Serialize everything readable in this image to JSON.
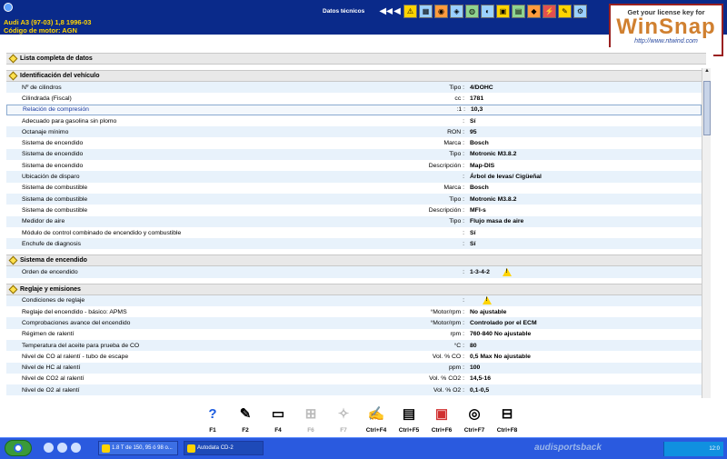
{
  "header": {
    "vehicle": "Audi  A3 (97-03) 1,8  1996-03",
    "engine": "Código de motor: AGN",
    "section_title": "Datos técnicos"
  },
  "toolbar": [
    "◀◀",
    "◀",
    "⚠",
    "▦",
    "◉",
    "◈",
    "◍",
    "◐",
    "▣",
    "▤",
    "◆",
    "⚡",
    "✎",
    "⚙"
  ],
  "winsnap": {
    "line1": "Get your license key for",
    "line2": "WinSnap",
    "line3": "http://www.ntwind.com"
  },
  "content": {
    "full_list": "Lista completa de datos",
    "sections": [
      {
        "title": "Identificación del vehículo",
        "rows": [
          {
            "label": "Nº de cilindros",
            "unit": "Tipo :",
            "value": "4/DOHC"
          },
          {
            "label": "Cilindrada (Fiscal)",
            "unit": "cc :",
            "value": "1781"
          },
          {
            "label": "Relación de compresión",
            "unit": ":1 :",
            "value": "10,3"
          },
          {
            "label": "Adecuado para gasolina sin plomo",
            "unit": ":",
            "value": "Sí"
          },
          {
            "label": "Octanaje mínimo",
            "unit": "RON :",
            "value": "95"
          },
          {
            "label": "Sistema de encendido",
            "unit": "Marca :",
            "value": "Bosch"
          },
          {
            "label": "Sistema de encendido",
            "unit": "Tipo :",
            "value": "Motronic M3.8.2"
          },
          {
            "label": "Sistema de encendido",
            "unit": "Descripción :",
            "value": "Map-DIS"
          },
          {
            "label": "Ubicación de disparo",
            "unit": ":",
            "value": "Árbol de levas/ Cigüeñal"
          },
          {
            "label": "Sistema de combustible",
            "unit": "Marca :",
            "value": "Bosch"
          },
          {
            "label": "Sistema de combustible",
            "unit": "Tipo :",
            "value": "Motronic M3.8.2"
          },
          {
            "label": "Sistema de combustible",
            "unit": "Descripción :",
            "value": "MFI-s"
          },
          {
            "label": "Medidor de aire",
            "unit": "Tipo :",
            "value": "Flujo masa de aire"
          },
          {
            "label": "Módulo de control combinado de encendido y combustible",
            "unit": ":",
            "value": "Sí"
          },
          {
            "label": "Enchufe de diagnosis",
            "unit": ":",
            "value": "Sí"
          }
        ]
      },
      {
        "title": "Sistema de encendido",
        "rows": [
          {
            "label": "Orden de encendido",
            "unit": ":",
            "value": "1-3-4-2"
          }
        ]
      },
      {
        "title": "Reglaje y emisiones",
        "rows": [
          {
            "label": "Condiciones de reglaje",
            "unit": ":",
            "value": ""
          },
          {
            "label": "Reglaje del encendido - básico: APMS",
            "unit": "°Motor/rpm :",
            "value": "No ajustable"
          },
          {
            "label": "Comprobaciones avance del encendido",
            "unit": "°Motor/rpm :",
            "value": "Controlado por el ECM"
          },
          {
            "label": "Régimen de ralentí",
            "unit": "rpm :",
            "value": "760-840 No ajustable"
          },
          {
            "label": "Temperatura del aceite para prueba de CO",
            "unit": "°C :",
            "value": "80"
          },
          {
            "label": "Nivel de CO al ralentí - tubo de escape",
            "unit": "Vol. % CO :",
            "value": "0,5 Max No ajustable"
          },
          {
            "label": "Nivel de HC al ralentí",
            "unit": "ppm :",
            "value": "100"
          },
          {
            "label": "Nivel de CO2 al ralentí",
            "unit": "Vol. % CO2 :",
            "value": "14,5-16"
          },
          {
            "label": "Nivel de O2 al ralentí",
            "unit": "Vol. % O2 :",
            "value": "0,1-0,5"
          }
        ]
      }
    ]
  },
  "fkeys": [
    {
      "label": "F1",
      "icon": "?",
      "disabled": false
    },
    {
      "label": "F2",
      "icon": "✎",
      "disabled": false
    },
    {
      "label": "F4",
      "icon": "▭",
      "disabled": false
    },
    {
      "label": "F6",
      "icon": "⊞",
      "disabled": true
    },
    {
      "label": "F7",
      "icon": "✧",
      "disabled": true
    },
    {
      "label": "Ctrl+F4",
      "icon": "✍",
      "disabled": false
    },
    {
      "label": "Ctrl+F5",
      "icon": "▤",
      "disabled": false
    },
    {
      "label": "Ctrl+F6",
      "icon": "▣",
      "disabled": false
    },
    {
      "label": "Ctrl+F7",
      "icon": "◎",
      "disabled": false
    },
    {
      "label": "Ctrl+F8",
      "icon": "⊟",
      "disabled": false
    }
  ],
  "taskbar": {
    "task1": "1.8 T de 150, 95 ó 98 o...",
    "task2": "Autodata CD-2",
    "watermark": "audisportsback",
    "clock": "12:0"
  }
}
